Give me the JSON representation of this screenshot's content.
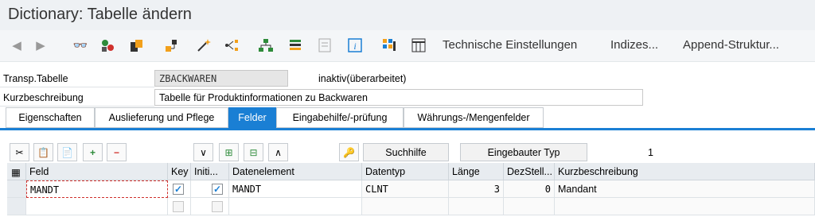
{
  "window": {
    "title": "Dictionary: Tabelle ändern"
  },
  "toolbar": {
    "icons": [
      "back-icon",
      "forward-icon",
      "glasses-icon",
      "objects-icon",
      "clipboard-icon",
      "hierarchy-icon",
      "magic-wand-icon",
      "tree-icon",
      "org-chart-icon",
      "layers-icon",
      "document-icon",
      "info-icon",
      "grid-icon",
      "table-icon"
    ],
    "buttons": [
      "Technische Einstellungen",
      "Indizes...",
      "Append-Struktur..."
    ]
  },
  "header": {
    "table_label": "Transp.Tabelle",
    "table_name": "ZBACKWAREN",
    "status": "inaktiv(überarbeitet)",
    "desc_label": "Kurzbeschreibung",
    "desc_value": "Tabelle für Produktinformationen zu Backwaren"
  },
  "tabs": [
    {
      "label": "Eigenschaften",
      "active": false
    },
    {
      "label": "Auslieferung und Pflege",
      "active": false
    },
    {
      "label": "Felder",
      "active": true
    },
    {
      "label": "Eingabehilfe/-prüfung",
      "active": false
    },
    {
      "label": "Währungs-/Mengenfelder",
      "active": false
    }
  ],
  "fields_toolbar": {
    "search_help": "Suchhilfe",
    "builtin_type": "Eingebauter Typ",
    "count": "1"
  },
  "table": {
    "columns": [
      "Feld",
      "Key",
      "Initi...",
      "Datenelement",
      "Datentyp",
      "Länge",
      "DezStell...",
      "Kurzbeschreibung"
    ],
    "rows": [
      {
        "feld": "MANDT",
        "key": true,
        "initial": true,
        "datenelement": "MANDT",
        "datentyp": "CLNT",
        "laenge": "3",
        "dezstell": "0",
        "kurzbeschreibung": "Mandant"
      }
    ]
  },
  "colors": {
    "accent": "#1a7fd4",
    "title_bg": "#eef1f4",
    "header_bg": "#e8ecf0"
  }
}
